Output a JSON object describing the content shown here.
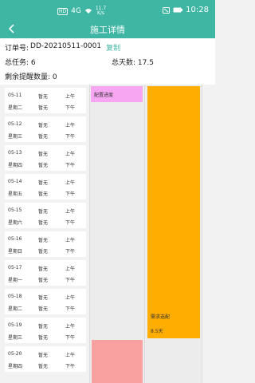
{
  "status_bar": {
    "carrier_badge": "HD",
    "network": "4G",
    "speed_value": "11.7",
    "speed_unit": "K/s",
    "time": "10:28"
  },
  "header": {
    "title": "施工详情"
  },
  "info": {
    "order_label": "订单号:",
    "order_no": "DD-20210511-0001",
    "copy_label": "复制",
    "tasks": "总任务: 6",
    "total_days": "总天数: 17.5",
    "remind": "剩余提醒数量: 0"
  },
  "days": [
    {
      "date": "05-11",
      "weekday": "星期二",
      "status_am": "暂无",
      "status_pm": "暂无",
      "am": "上午",
      "pm": "下午"
    },
    {
      "date": "05-12",
      "weekday": "星期三",
      "status_am": "暂无",
      "status_pm": "暂无",
      "am": "上午",
      "pm": "下午"
    },
    {
      "date": "05-13",
      "weekday": "星期四",
      "status_am": "暂无",
      "status_pm": "暂无",
      "am": "上午",
      "pm": "下午"
    },
    {
      "date": "05-14",
      "weekday": "星期五",
      "status_am": "暂无",
      "status_pm": "暂无",
      "am": "上午",
      "pm": "下午"
    },
    {
      "date": "05-15",
      "weekday": "星期六",
      "status_am": "暂无",
      "status_pm": "暂无",
      "am": "上午",
      "pm": "下午"
    },
    {
      "date": "05-16",
      "weekday": "星期日",
      "status_am": "暂无",
      "status_pm": "暂无",
      "am": "上午",
      "pm": "下午"
    },
    {
      "date": "05-17",
      "weekday": "星期一",
      "status_am": "暂无",
      "status_pm": "暂无",
      "am": "上午",
      "pm": "下午"
    },
    {
      "date": "05-18",
      "weekday": "星期二",
      "status_am": "暂无",
      "status_pm": "暂无",
      "am": "上午",
      "pm": "下午"
    },
    {
      "date": "05-19",
      "weekday": "星期三",
      "status_am": "暂无",
      "status_pm": "暂无",
      "am": "上午",
      "pm": "下午"
    },
    {
      "date": "05-20",
      "weekday": "星期四",
      "status_am": "暂无",
      "status_pm": "暂无",
      "am": "上午",
      "pm": "下午"
    }
  ],
  "tasks": {
    "pink": {
      "name": "配置进度"
    },
    "orange": {
      "name": "需求选配",
      "duration": "8.5天"
    }
  },
  "colors": {
    "brand": "#3eb6a3",
    "pink_task": "#f7a7f2",
    "orange_task": "#ffad00",
    "red_task": "#f9a1a1"
  }
}
